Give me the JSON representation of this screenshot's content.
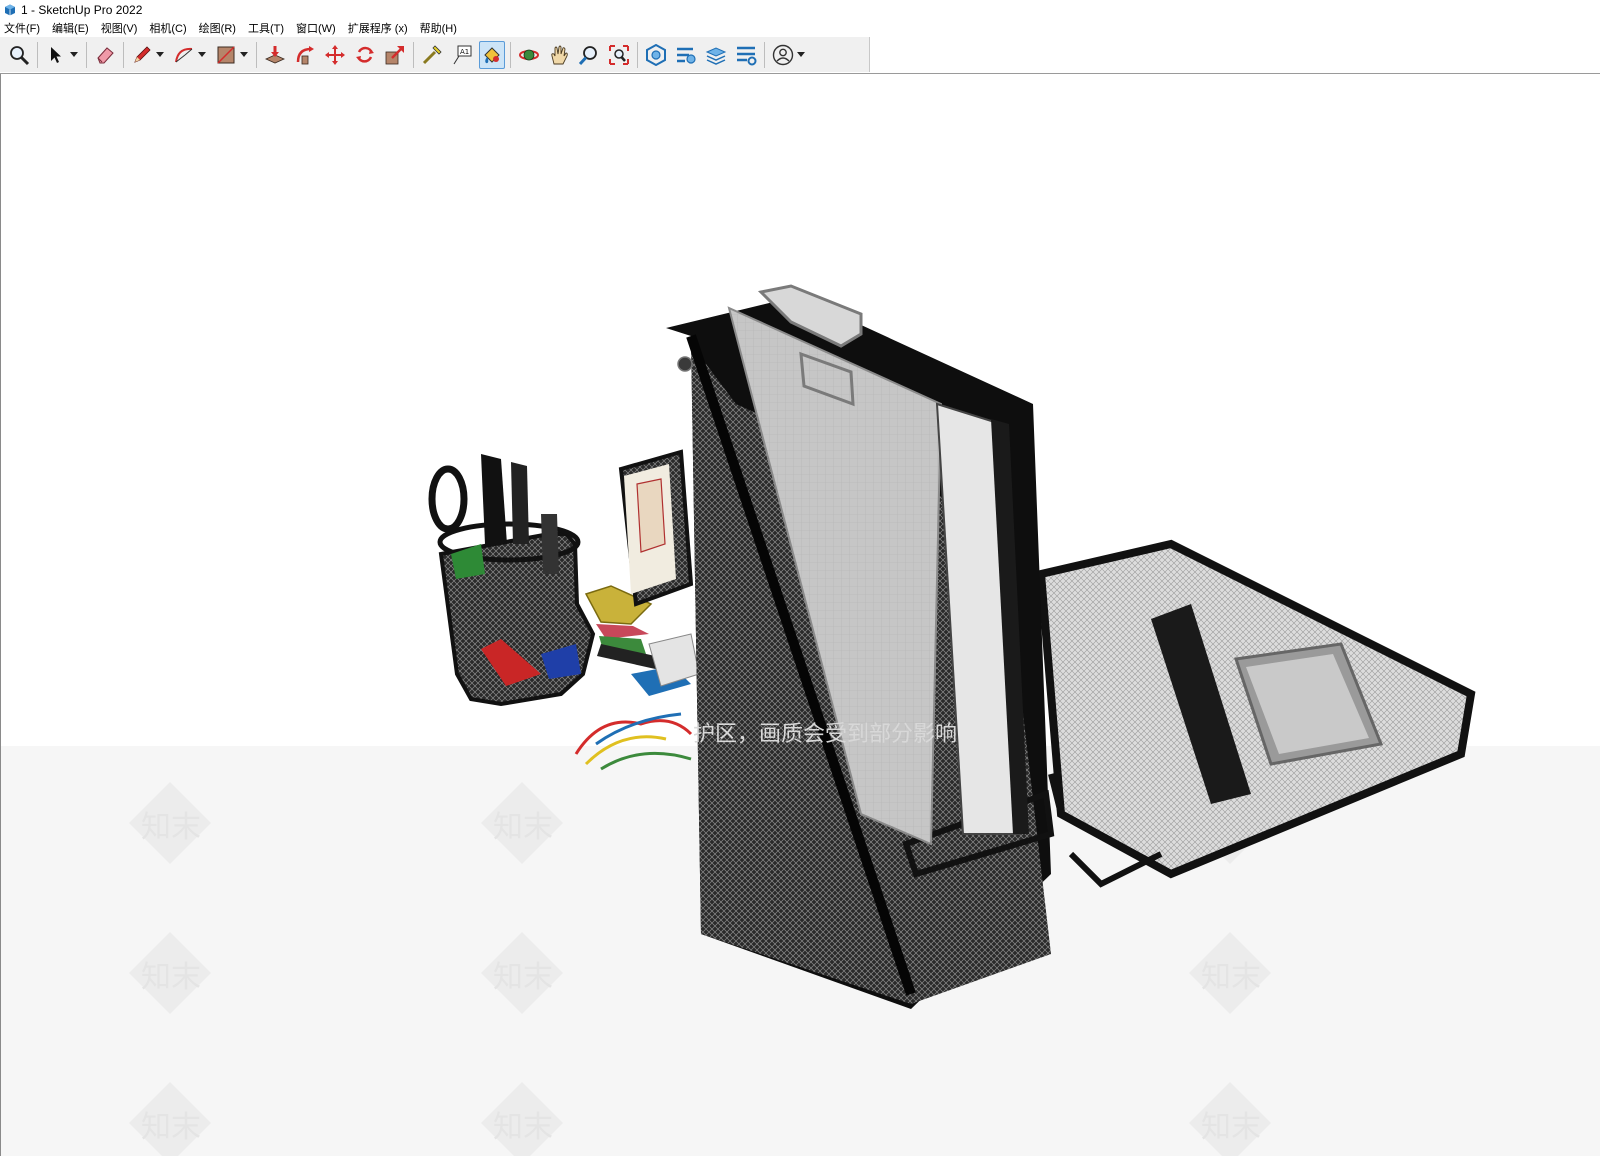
{
  "window": {
    "title": "1 - SketchUp Pro 2022"
  },
  "menu": [
    {
      "label": "文件(F)"
    },
    {
      "label": "编辑(E)"
    },
    {
      "label": "视图(V)"
    },
    {
      "label": "相机(C)"
    },
    {
      "label": "绘图(R)"
    },
    {
      "label": "工具(T)"
    },
    {
      "label": "窗口(W)"
    },
    {
      "label": "扩展程序 (x)"
    },
    {
      "label": "帮助(H)"
    }
  ],
  "toolbar": {
    "tools": [
      "zoom-icon",
      "select-icon",
      "eraser-icon",
      "pencil-line-icon",
      "arc-icon",
      "rectangle-icon",
      "push-pull-icon",
      "follow-me-icon",
      "move-icon",
      "rotate-icon",
      "scale-icon",
      "tape-measure-icon",
      "text-icon",
      "paint-bucket-icon",
      "orbit-icon",
      "pan-icon",
      "zoom-view-icon",
      "zoom-extents-icon",
      "3d-warehouse-icon",
      "extension-warehouse-icon",
      "layout-icon",
      "extension-manager-icon",
      "account-icon"
    ],
    "active_tool": "paint-bucket-icon"
  },
  "viewport": {
    "watermark_text": "知末",
    "banner_text": "护区，画质会受到部分影响"
  },
  "colors": {
    "toolbar_bg": "#f0f0f0",
    "active_tool_bg": "#cce4f7",
    "accent_red": "#d42c2c",
    "accent_blue": "#1f6fb5"
  }
}
